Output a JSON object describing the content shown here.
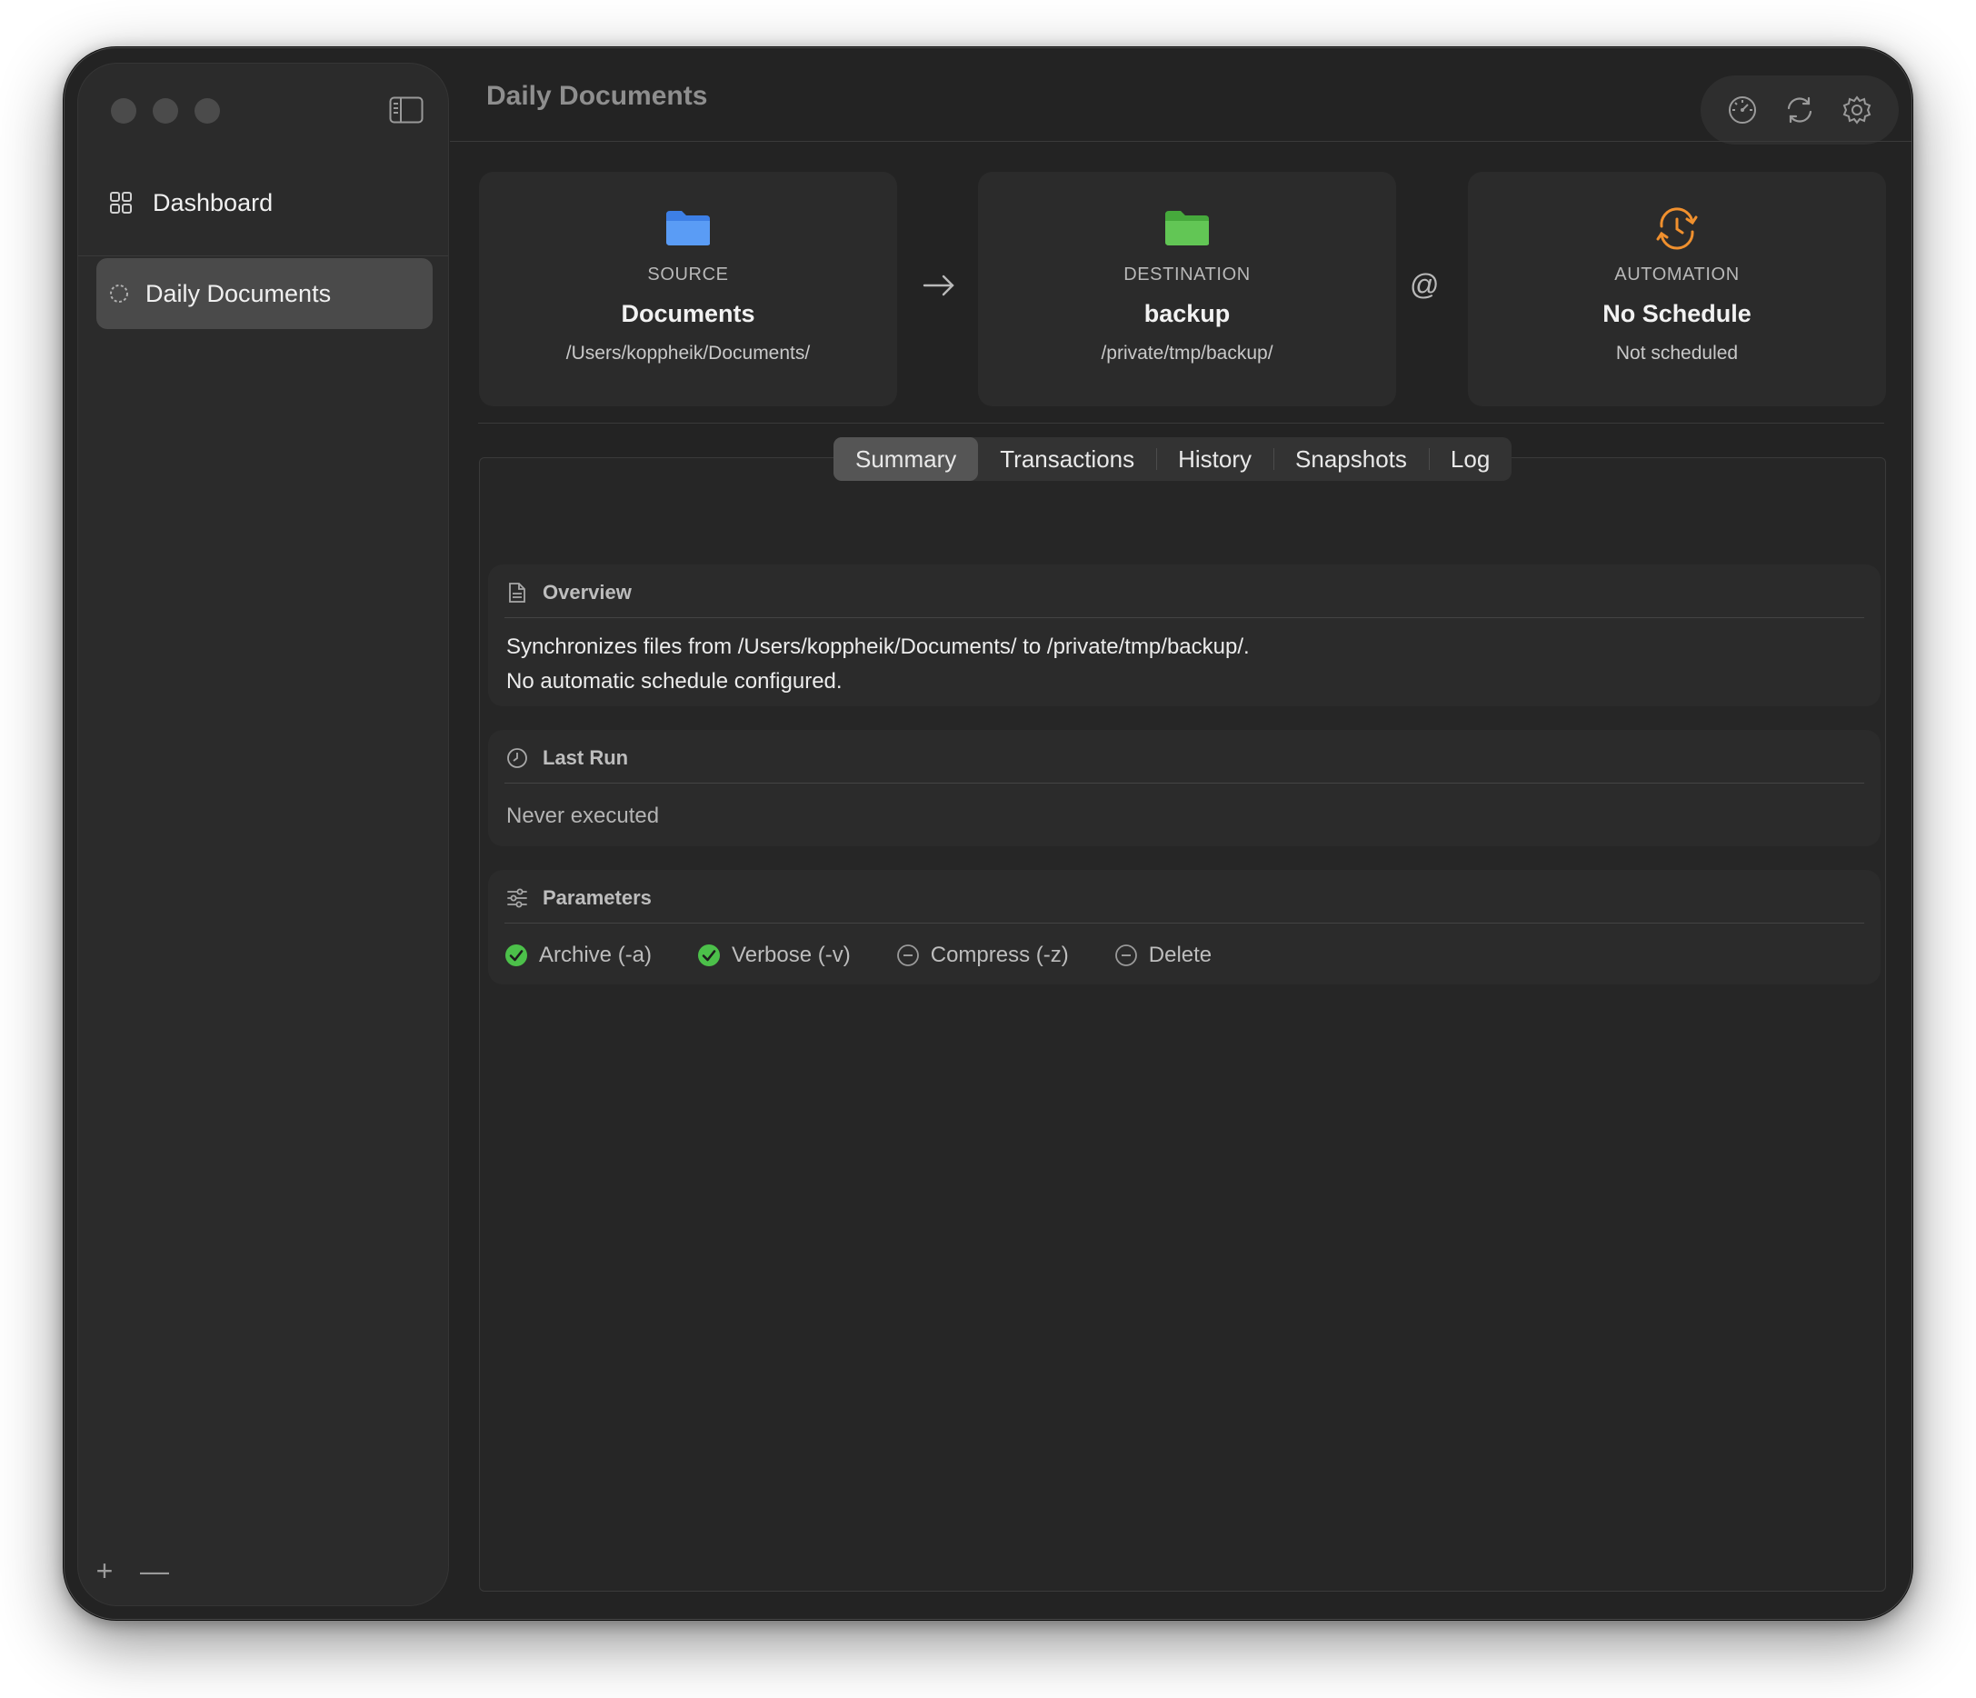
{
  "window": {
    "title": "Daily Documents"
  },
  "sidebar": {
    "items": [
      {
        "label": "Dashboard",
        "icon": "grid-icon"
      },
      {
        "label": "Daily Documents",
        "icon": "circle-dashed-icon",
        "selected": true
      }
    ],
    "footer": {
      "add": "+",
      "remove": "—"
    }
  },
  "toolbar": {
    "buttons": [
      "gauge-icon",
      "sync-icon",
      "gear-icon"
    ]
  },
  "cards": {
    "source": {
      "caption": "SOURCE",
      "name": "Documents",
      "path": "/Users/koppheik/Documents/",
      "icon": "folder-icon",
      "color": "#4a8ef0"
    },
    "destination": {
      "caption": "DESTINATION",
      "name": "backup",
      "path": "/private/tmp/backup/",
      "icon": "folder-icon",
      "color": "#5cc44f"
    },
    "automation": {
      "caption": "AUTOMATION",
      "name": "No Schedule",
      "path": "Not scheduled",
      "icon": "clock-history-icon",
      "color": "#f0902e"
    },
    "at_symbol": "@"
  },
  "tabs": [
    {
      "label": "Summary",
      "active": true
    },
    {
      "label": "Transactions"
    },
    {
      "label": "History"
    },
    {
      "label": "Snapshots"
    },
    {
      "label": "Log"
    }
  ],
  "overview": {
    "title": "Overview",
    "line1": "Synchronizes files from /Users/koppheik/Documents/ to /private/tmp/backup/.",
    "line2": "No automatic schedule configured."
  },
  "last_run": {
    "title": "Last Run",
    "value": "Never executed"
  },
  "parameters": {
    "title": "Parameters",
    "items": [
      {
        "label": "Archive (-a)",
        "enabled": true
      },
      {
        "label": "Verbose (-v)",
        "enabled": true
      },
      {
        "label": "Compress (-z)",
        "enabled": false
      },
      {
        "label": "Delete",
        "enabled": false
      }
    ]
  },
  "colors": {
    "enabled": "#4cc04a",
    "disabled": "#9a9a9a"
  }
}
